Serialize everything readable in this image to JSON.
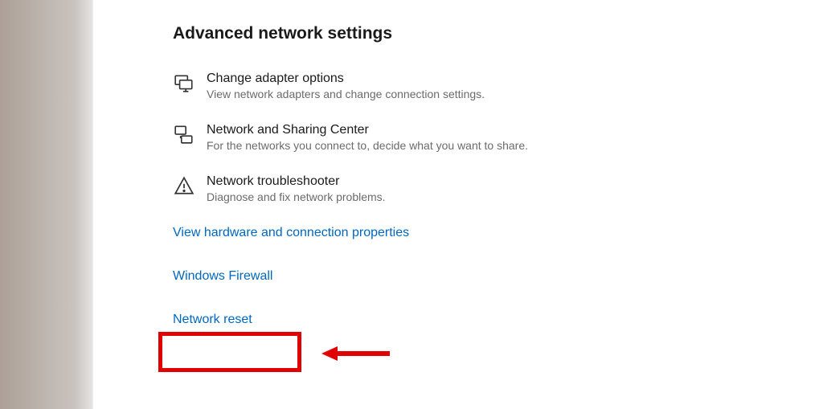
{
  "section": {
    "title": "Advanced network settings"
  },
  "items": [
    {
      "icon": "adapter-icon",
      "heading": "Change adapter options",
      "desc": "View network adapters and change connection settings."
    },
    {
      "icon": "sharing-icon",
      "heading": "Network and Sharing Center",
      "desc": "For the networks you connect to, decide what you want to share."
    },
    {
      "icon": "warning-icon",
      "heading": "Network troubleshooter",
      "desc": "Diagnose and fix network problems."
    }
  ],
  "links": [
    "View hardware and connection properties",
    "Windows Firewall",
    "Network reset"
  ]
}
